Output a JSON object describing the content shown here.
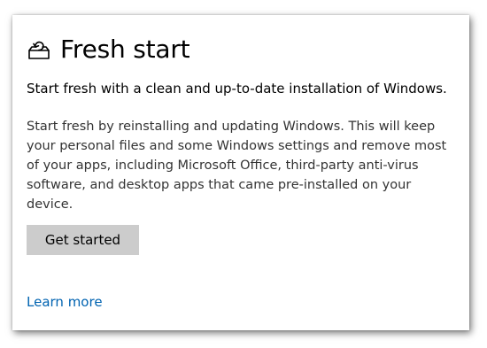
{
  "page": {
    "title": "Fresh start",
    "subtitle": "Start fresh with a clean and up-to-date installation of Windows.",
    "description": "Start fresh by reinstalling and updating Windows. This will keep your personal files and some Windows settings and remove most of your apps, including Microsoft Office, third-party anti-virus software, and desktop apps that came pre-installed on your device.",
    "icon": "fresh-start-icon"
  },
  "actions": {
    "get_started_label": "Get started",
    "learn_more_label": "Learn more"
  },
  "colors": {
    "button_bg": "#cccccc",
    "link": "#0063b1",
    "text_primary": "#000000",
    "text_secondary": "#333333"
  }
}
